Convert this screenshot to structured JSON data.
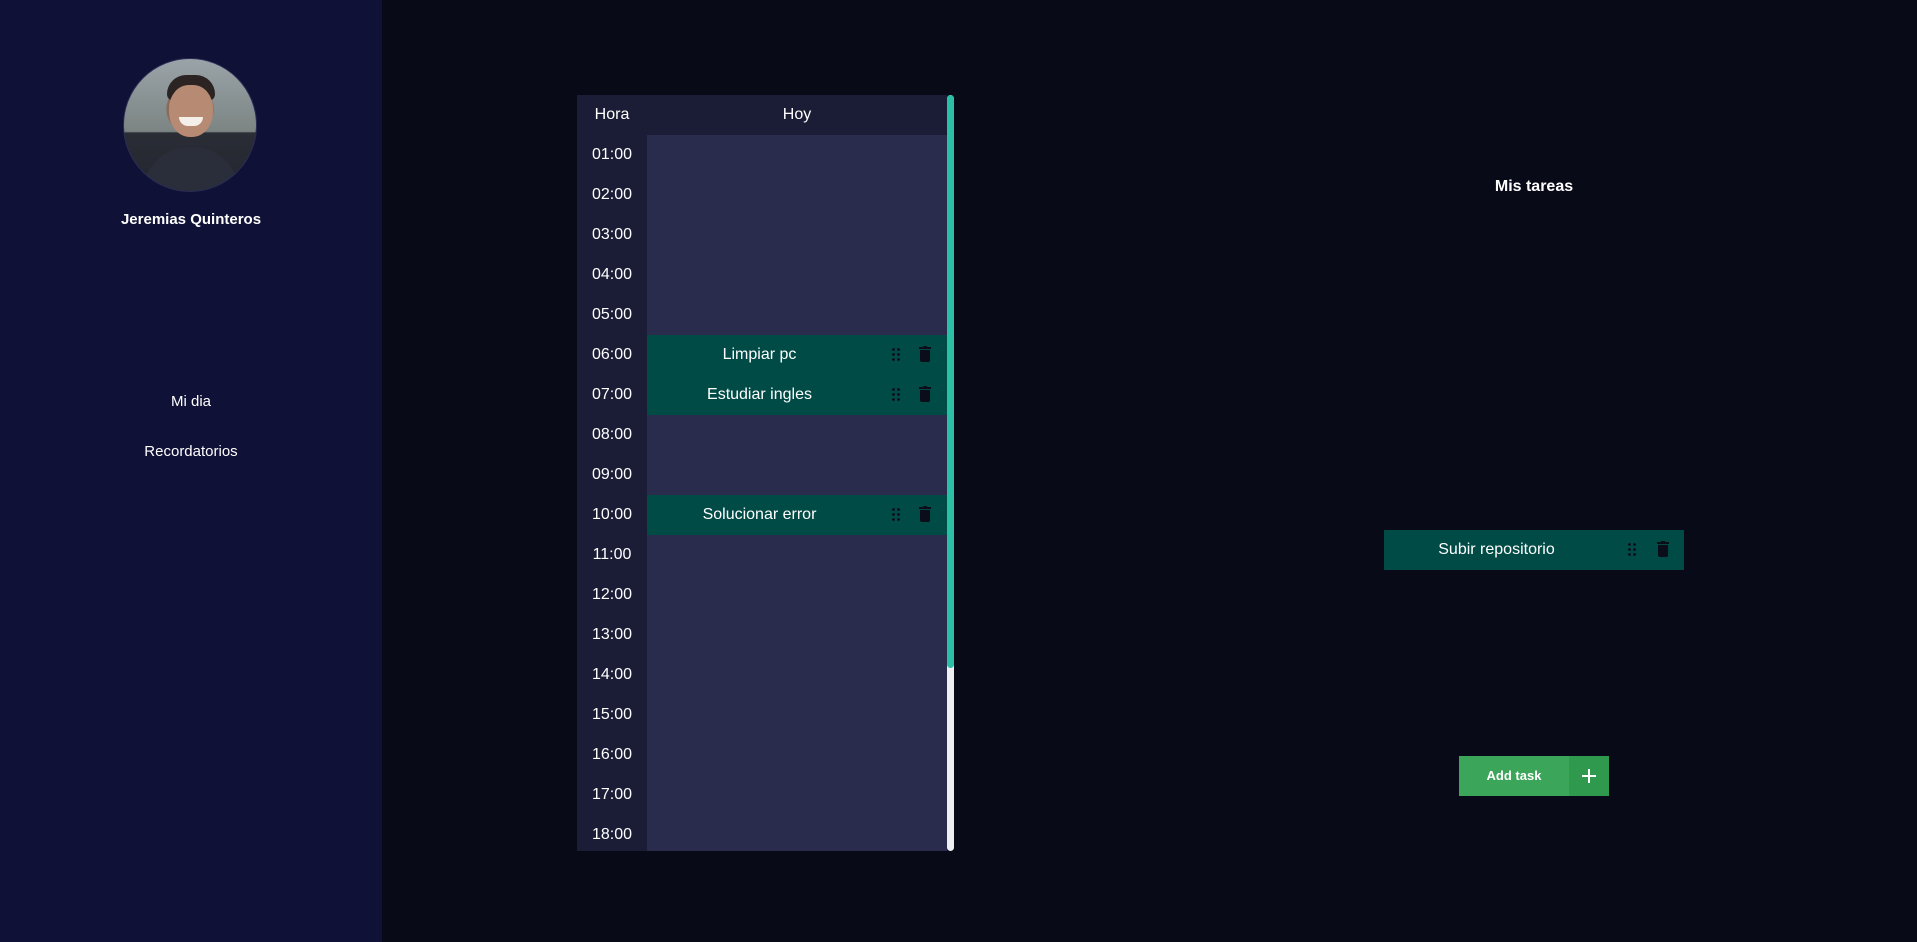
{
  "sidebar": {
    "user_name": "Jeremias Quinteros",
    "nav": [
      {
        "label": "Mi dia"
      },
      {
        "label": "Recordatorios"
      }
    ]
  },
  "schedule": {
    "header_hour": "Hora",
    "header_day": "Hoy",
    "hours": [
      "01:00",
      "02:00",
      "03:00",
      "04:00",
      "05:00",
      "06:00",
      "07:00",
      "08:00",
      "09:00",
      "10:00",
      "11:00",
      "12:00",
      "13:00",
      "14:00",
      "15:00",
      "16:00",
      "17:00",
      "18:00"
    ],
    "tasks": [
      {
        "hour": "06:00",
        "title": "Limpiar pc"
      },
      {
        "hour": "07:00",
        "title": "Estudiar ingles"
      },
      {
        "hour": "10:00",
        "title": "Solucionar error"
      }
    ]
  },
  "my_tasks": {
    "title": "Mis tareas",
    "items": [
      {
        "title": "Subir repositorio"
      }
    ],
    "add_label": "Add task"
  },
  "colors": {
    "sidebar_bg": "#0f1136",
    "page_bg": "#080a17",
    "task_bg": "#004b45",
    "accent": "#2bbfa5",
    "add_button": "#3ba55a"
  }
}
